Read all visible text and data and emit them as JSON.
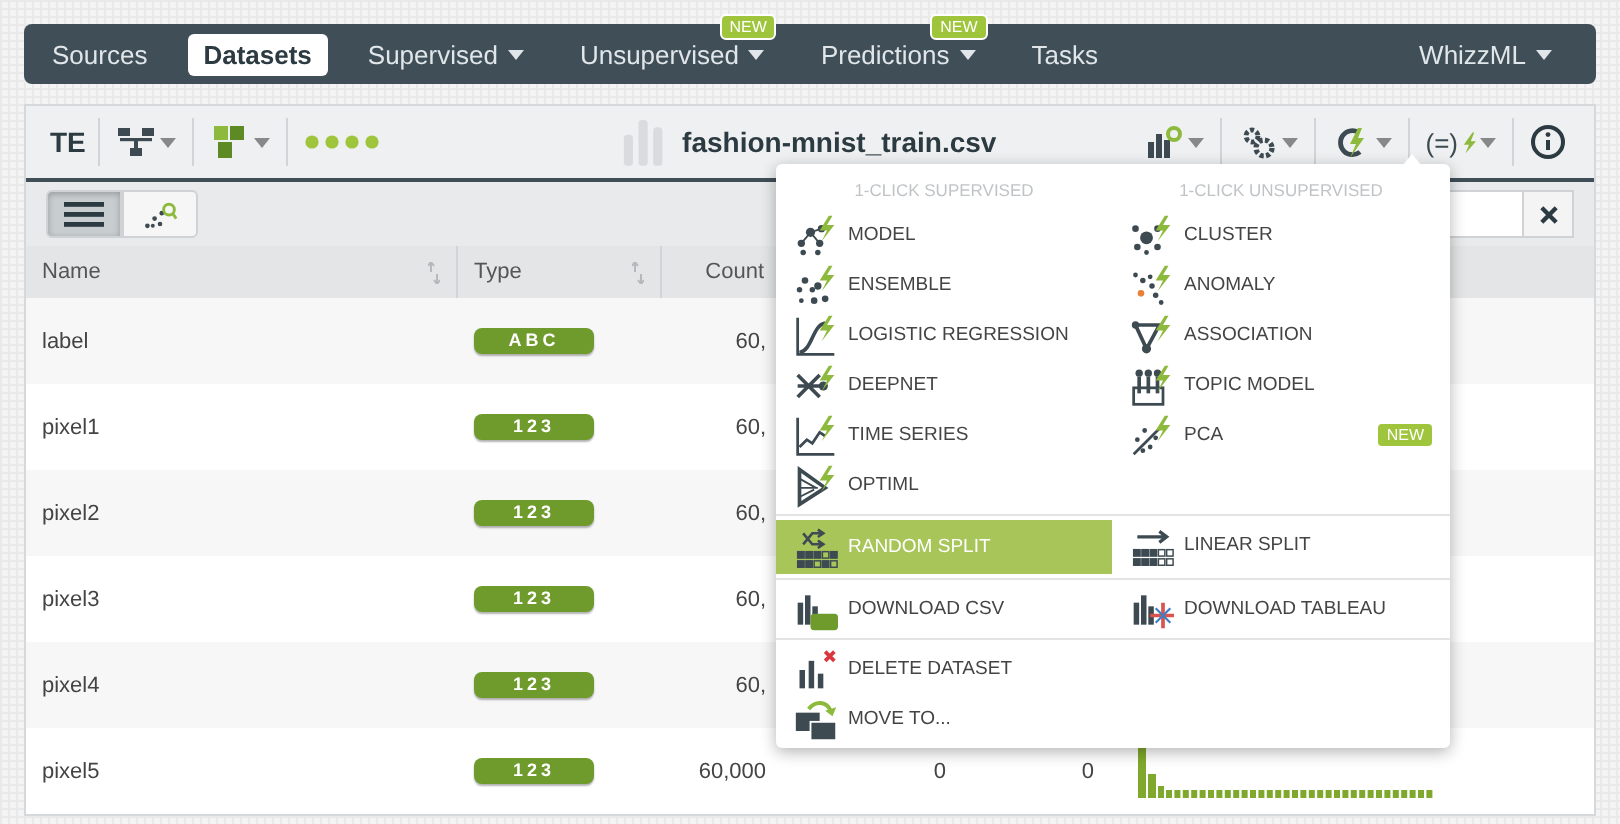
{
  "nav": {
    "items": [
      {
        "label": "Sources",
        "selected": false,
        "dropdown": false
      },
      {
        "label": "Datasets",
        "selected": true,
        "dropdown": false
      },
      {
        "label": "Supervised",
        "selected": false,
        "dropdown": true
      },
      {
        "label": "Unsupervised",
        "selected": false,
        "dropdown": true,
        "badge": "NEW"
      },
      {
        "label": "Predictions",
        "selected": false,
        "dropdown": true,
        "badge": "NEW"
      },
      {
        "label": "Tasks",
        "selected": false,
        "dropdown": false
      }
    ],
    "account": {
      "label": "WhizzML",
      "dropdown": true
    }
  },
  "toolbar": {
    "tag": "TE",
    "title": "fashion-mnist_train.csv",
    "formula_label": "(=)"
  },
  "view_toggle": [
    {
      "kind": "list",
      "selected": true
    },
    {
      "kind": "graph",
      "selected": false
    }
  ],
  "table": {
    "columns": [
      {
        "label": "Name",
        "sortable": true
      },
      {
        "label": "Type",
        "sortable": true
      },
      {
        "label": "Count",
        "sortable": false
      }
    ],
    "rows": [
      {
        "name": "label",
        "type": "ABC",
        "count": "60,"
      },
      {
        "name": "pixel1",
        "type": "123",
        "count": "60,"
      },
      {
        "name": "pixel2",
        "type": "123",
        "count": "60,"
      },
      {
        "name": "pixel3",
        "type": "123",
        "count": "60,"
      },
      {
        "name": "pixel4",
        "type": "123",
        "count": "60,"
      },
      {
        "name": "pixel5",
        "type": "123",
        "count": "60,000",
        "column_4": "0",
        "column_5": "0",
        "histogram": true
      }
    ]
  },
  "menu": {
    "supervised_header": "1-CLICK SUPERVISED",
    "unsupervised_header": "1-CLICK UNSUPERVISED",
    "supervised": [
      {
        "label": "MODEL",
        "kind": "model"
      },
      {
        "label": "ENSEMBLE",
        "kind": "ensemble"
      },
      {
        "label": "LOGISTIC REGRESSION",
        "kind": "logistic"
      },
      {
        "label": "DEEPNET",
        "kind": "deepnet"
      },
      {
        "label": "TIME SERIES",
        "kind": "timeseries"
      },
      {
        "label": "OPTIML",
        "kind": "optiml"
      }
    ],
    "unsupervised": [
      {
        "label": "CLUSTER",
        "kind": "cluster"
      },
      {
        "label": "ANOMALY",
        "kind": "anomaly"
      },
      {
        "label": "ASSOCIATION",
        "kind": "association"
      },
      {
        "label": "TOPIC MODEL",
        "kind": "topic"
      },
      {
        "label": "PCA",
        "kind": "pca",
        "badge": "NEW"
      }
    ],
    "groups": [
      {
        "kind": "pair",
        "items": [
          {
            "label": "RANDOM SPLIT",
            "kind": "random-split",
            "selected": true
          },
          {
            "label": "LINEAR SPLIT",
            "kind": "linear-split",
            "selected": false
          }
        ]
      },
      {
        "kind": "pair",
        "items": [
          {
            "label": "DOWNLOAD CSV",
            "kind": "csv",
            "selected": false
          },
          {
            "label": "DOWNLOAD TABLEAU",
            "kind": "tableau",
            "selected": false
          }
        ]
      },
      {
        "kind": "stack",
        "items": [
          {
            "label": "DELETE DATASET",
            "kind": "delete",
            "selected": false
          },
          {
            "label": "MOVE TO...",
            "kind": "move",
            "selected": false
          }
        ]
      }
    ]
  }
}
